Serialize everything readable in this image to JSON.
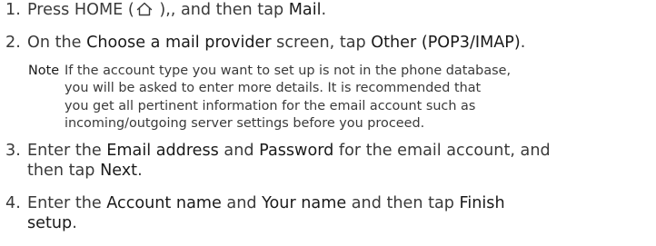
{
  "steps": [
    {
      "number": "1.",
      "parts": [
        "Press HOME (",
        ", and then tap ",
        "Mail",
        "."
      ],
      "after_icon": " ),",
      "icon": "home-icon"
    },
    {
      "number": "2.",
      "parts": [
        "On the ",
        "Choose a mail provider",
        " screen, tap ",
        "Other (POP3/IMAP)",
        "."
      ]
    },
    {
      "number": "3.",
      "line1": [
        "Enter the ",
        "Email address",
        " and ",
        "Password",
        " for the email account, and"
      ],
      "line2": [
        "then tap ",
        "Next",
        "."
      ]
    },
    {
      "number": "4.",
      "line1": [
        "Enter the ",
        "Account name",
        " and ",
        "Your name",
        " and then tap ",
        "Finish"
      ],
      "line2": [
        "setup",
        "."
      ]
    }
  ],
  "note": {
    "label": "Note",
    "lines": [
      "If the account type you want to set up is not in the phone database,",
      "you will be asked to enter more details. It is recommended that",
      "you get all pertinent information for the email account such as",
      "incoming/outgoing server settings before you proceed."
    ]
  }
}
